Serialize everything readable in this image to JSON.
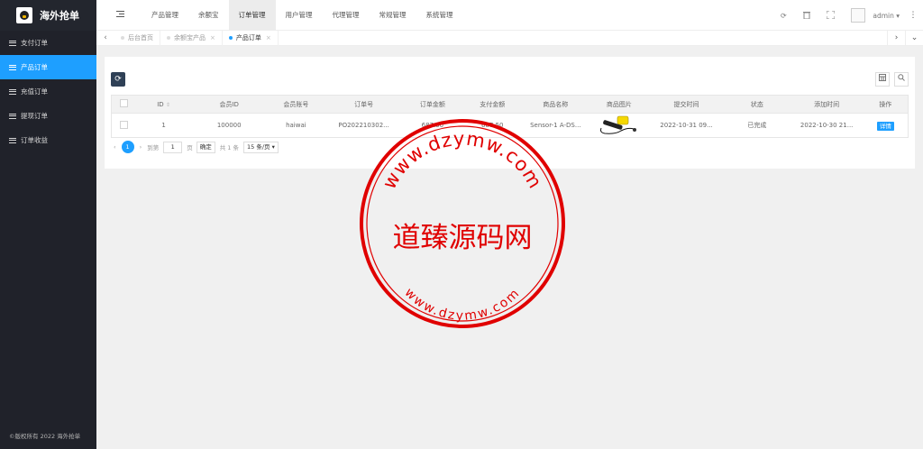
{
  "app": {
    "title": "海外抢单",
    "copyright": "©版权所有 2022 海外抢单"
  },
  "sidebar": {
    "items": [
      {
        "label": "支付订单",
        "active": false
      },
      {
        "label": "产品订单",
        "active": true
      },
      {
        "label": "充值订单",
        "active": false
      },
      {
        "label": "提现订单",
        "active": false
      },
      {
        "label": "订单收益",
        "active": false
      }
    ]
  },
  "header": {
    "nav": [
      {
        "label": "产品管理",
        "active": false
      },
      {
        "label": "余额宝",
        "active": false
      },
      {
        "label": "订单管理",
        "active": true
      },
      {
        "label": "用户管理",
        "active": false
      },
      {
        "label": "代理管理",
        "active": false
      },
      {
        "label": "常规管理",
        "active": false
      },
      {
        "label": "系统管理",
        "active": false
      }
    ],
    "user": "admin",
    "icons": {
      "refresh": "⟳",
      "clear": "🗑",
      "fullscreen": "⤧",
      "more": "⋮",
      "caret": "▾"
    }
  },
  "tabs": [
    {
      "label": "后台首页",
      "active": false,
      "closable": false
    },
    {
      "label": "余额宝产品",
      "active": false,
      "closable": true
    },
    {
      "label": "产品订单",
      "active": true,
      "closable": true
    }
  ],
  "table": {
    "columns": [
      "ID",
      "会员ID",
      "会员账号",
      "订单号",
      "订单金额",
      "支付金额",
      "商品名称",
      "商品图片",
      "提交时间",
      "状态",
      "添加时间",
      "操作"
    ],
    "rows": [
      {
        "id": "1",
        "member_id": "100000",
        "account": "haiwai",
        "order_no": "PO202210302...",
        "order_amount": "687.50",
        "pay_amount": "687.50",
        "product": "Sensor-1 A-DS...",
        "submit_time": "2022-10-31 09...",
        "status": "已完成",
        "add_time": "2022-10-30 21...",
        "action": "详情"
      }
    ]
  },
  "pager": {
    "current": "1",
    "goto_label": "到第",
    "page_input": "1",
    "page_unit": "页",
    "confirm": "确定",
    "total": "共 1 条",
    "per_page": "15 条/页"
  },
  "watermark": {
    "center": "道臻源码网",
    "top": "www.dzymw.com",
    "bottom": "www.dzymw.com",
    "color": "#e00000"
  }
}
